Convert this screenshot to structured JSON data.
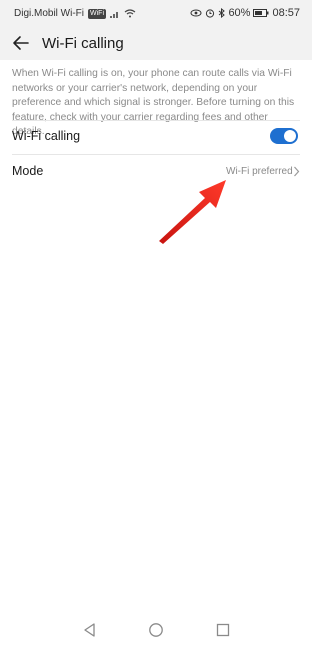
{
  "status": {
    "carrier": "Digi.Mobil Wi-Fi",
    "wifi_badge": "WiFi",
    "battery": "60%",
    "time": "08:57"
  },
  "header": {
    "title": "Wi-Fi calling"
  },
  "description": "When Wi-Fi calling is on, your phone can route calls via Wi-Fi networks or your carrier's network, depending on your preference and which signal is stronger. Before turning on this feature, check with your carrier regarding fees and other details.",
  "settings": {
    "wifi_calling_label": "Wi-Fi calling",
    "wifi_calling_on": true,
    "mode_label": "Mode",
    "mode_value": "Wi-Fi preferred"
  },
  "colors": {
    "accent": "#1e6fd0",
    "arrow": "#e8201a"
  },
  "icons": [
    "back-arrow-icon",
    "chevron-right-icon",
    "nav-back-icon",
    "nav-home-icon",
    "nav-recents-icon"
  ]
}
